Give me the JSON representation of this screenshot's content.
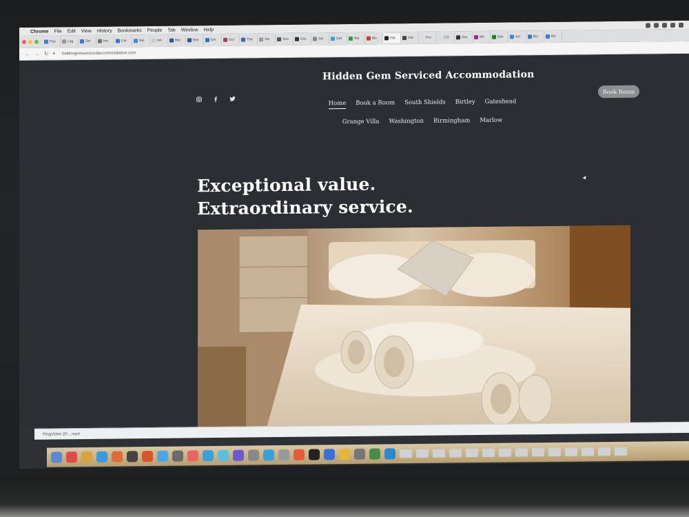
{
  "menubar": {
    "app": "Chrome",
    "items": [
      "File",
      "Edit",
      "View",
      "History",
      "Bookmarks",
      "People",
      "Tab",
      "Window",
      "Help"
    ]
  },
  "tabs": [
    {
      "label": "Pau",
      "color": "#4a7bd0"
    },
    {
      "label": "Log",
      "color": "#999999"
    },
    {
      "label": "Zer",
      "color": "#3b7bd8"
    },
    {
      "label": "Inn",
      "color": "#777777"
    },
    {
      "label": "Cer",
      "color": "#4a72c4"
    },
    {
      "label": "Nin",
      "color": "#3b8ed8"
    },
    {
      "label": "Inb",
      "color": "#cccccc"
    },
    {
      "label": "Bre",
      "color": "#2a57a0"
    },
    {
      "label": "Bes",
      "color": "#2a57a0"
    },
    {
      "label": "Em",
      "color": "#3b6fc0"
    },
    {
      "label": "Gui",
      "color": "#b03a6a"
    },
    {
      "label": "The",
      "color": "#2d6ab5"
    },
    {
      "label": "Ser",
      "color": "#999999"
    },
    {
      "label": "Sxo",
      "color": "#555555"
    },
    {
      "label": "Cnc",
      "color": "#333333"
    },
    {
      "label": "Ser",
      "color": "#888888"
    },
    {
      "label": "Get",
      "color": "#3aa0d8"
    },
    {
      "label": "Wo",
      "color": "#3a9a3a"
    },
    {
      "label": "Mu",
      "color": "#c63a3a"
    },
    {
      "label": "Hid",
      "color": "#222222"
    },
    {
      "label": "Hot",
      "color": "#444444"
    },
    {
      "label": "Pro",
      "color": "#dddddd"
    },
    {
      "label": "2 D",
      "color": "#dddddd"
    },
    {
      "label": "Sav",
      "color": "#333333"
    },
    {
      "label": "BR",
      "color": "#9b2b8a"
    },
    {
      "label": "Gre",
      "color": "#2d7a2d"
    },
    {
      "label": "Arc",
      "color": "#3a8ad0"
    },
    {
      "label": "Biz",
      "color": "#3a7ad0"
    },
    {
      "label": "Biz",
      "color": "#3a7ad0"
    }
  ],
  "address": {
    "url": "hiddengemservicedaccommodation.com"
  },
  "site": {
    "title": "Hidden Gem Serviced Accommodation",
    "social": [
      "instagram-icon",
      "facebook-icon",
      "twitter-icon"
    ],
    "nav": [
      "Home",
      "Book a Room",
      "South Shields",
      "Birtley",
      "Gateshead",
      "Grange Villa",
      "Washington",
      "Birmingham",
      "Marlow"
    ],
    "book_button": "Book Room",
    "hero_line1": "Exceptional value.",
    "hero_line2": "Extraordinary service."
  },
  "download": {
    "filename": "PingVideo 20....mp4"
  },
  "colors": {
    "site_bg": "#2b2e32",
    "button_bg": "#8d8f92",
    "text": "#ffffff"
  }
}
